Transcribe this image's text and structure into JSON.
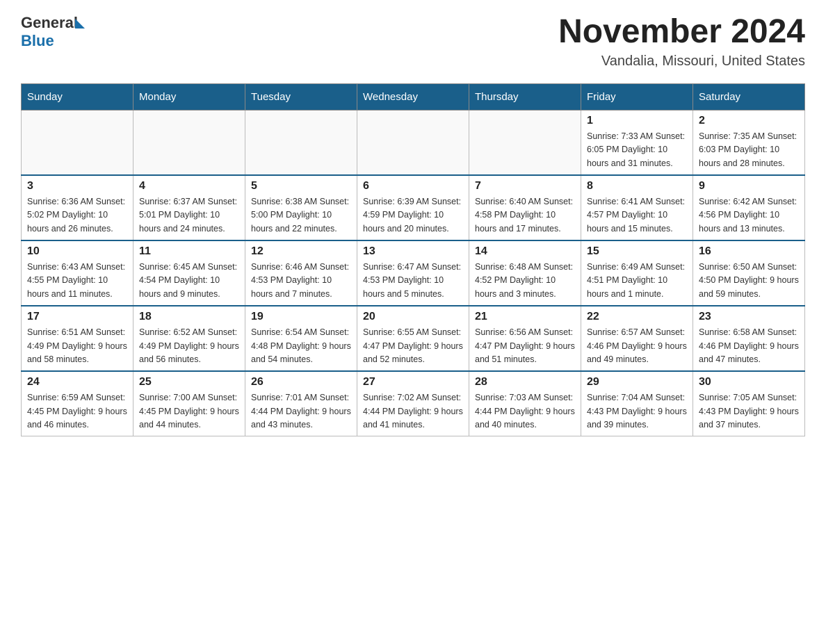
{
  "header": {
    "logo_general": "General",
    "logo_blue": "Blue",
    "month_year": "November 2024",
    "location": "Vandalia, Missouri, United States"
  },
  "days_of_week": [
    "Sunday",
    "Monday",
    "Tuesday",
    "Wednesday",
    "Thursday",
    "Friday",
    "Saturday"
  ],
  "weeks": [
    [
      {
        "day": "",
        "info": ""
      },
      {
        "day": "",
        "info": ""
      },
      {
        "day": "",
        "info": ""
      },
      {
        "day": "",
        "info": ""
      },
      {
        "day": "",
        "info": ""
      },
      {
        "day": "1",
        "info": "Sunrise: 7:33 AM\nSunset: 6:05 PM\nDaylight: 10 hours and 31 minutes."
      },
      {
        "day": "2",
        "info": "Sunrise: 7:35 AM\nSunset: 6:03 PM\nDaylight: 10 hours and 28 minutes."
      }
    ],
    [
      {
        "day": "3",
        "info": "Sunrise: 6:36 AM\nSunset: 5:02 PM\nDaylight: 10 hours and 26 minutes."
      },
      {
        "day": "4",
        "info": "Sunrise: 6:37 AM\nSunset: 5:01 PM\nDaylight: 10 hours and 24 minutes."
      },
      {
        "day": "5",
        "info": "Sunrise: 6:38 AM\nSunset: 5:00 PM\nDaylight: 10 hours and 22 minutes."
      },
      {
        "day": "6",
        "info": "Sunrise: 6:39 AM\nSunset: 4:59 PM\nDaylight: 10 hours and 20 minutes."
      },
      {
        "day": "7",
        "info": "Sunrise: 6:40 AM\nSunset: 4:58 PM\nDaylight: 10 hours and 17 minutes."
      },
      {
        "day": "8",
        "info": "Sunrise: 6:41 AM\nSunset: 4:57 PM\nDaylight: 10 hours and 15 minutes."
      },
      {
        "day": "9",
        "info": "Sunrise: 6:42 AM\nSunset: 4:56 PM\nDaylight: 10 hours and 13 minutes."
      }
    ],
    [
      {
        "day": "10",
        "info": "Sunrise: 6:43 AM\nSunset: 4:55 PM\nDaylight: 10 hours and 11 minutes."
      },
      {
        "day": "11",
        "info": "Sunrise: 6:45 AM\nSunset: 4:54 PM\nDaylight: 10 hours and 9 minutes."
      },
      {
        "day": "12",
        "info": "Sunrise: 6:46 AM\nSunset: 4:53 PM\nDaylight: 10 hours and 7 minutes."
      },
      {
        "day": "13",
        "info": "Sunrise: 6:47 AM\nSunset: 4:53 PM\nDaylight: 10 hours and 5 minutes."
      },
      {
        "day": "14",
        "info": "Sunrise: 6:48 AM\nSunset: 4:52 PM\nDaylight: 10 hours and 3 minutes."
      },
      {
        "day": "15",
        "info": "Sunrise: 6:49 AM\nSunset: 4:51 PM\nDaylight: 10 hours and 1 minute."
      },
      {
        "day": "16",
        "info": "Sunrise: 6:50 AM\nSunset: 4:50 PM\nDaylight: 9 hours and 59 minutes."
      }
    ],
    [
      {
        "day": "17",
        "info": "Sunrise: 6:51 AM\nSunset: 4:49 PM\nDaylight: 9 hours and 58 minutes."
      },
      {
        "day": "18",
        "info": "Sunrise: 6:52 AM\nSunset: 4:49 PM\nDaylight: 9 hours and 56 minutes."
      },
      {
        "day": "19",
        "info": "Sunrise: 6:54 AM\nSunset: 4:48 PM\nDaylight: 9 hours and 54 minutes."
      },
      {
        "day": "20",
        "info": "Sunrise: 6:55 AM\nSunset: 4:47 PM\nDaylight: 9 hours and 52 minutes."
      },
      {
        "day": "21",
        "info": "Sunrise: 6:56 AM\nSunset: 4:47 PM\nDaylight: 9 hours and 51 minutes."
      },
      {
        "day": "22",
        "info": "Sunrise: 6:57 AM\nSunset: 4:46 PM\nDaylight: 9 hours and 49 minutes."
      },
      {
        "day": "23",
        "info": "Sunrise: 6:58 AM\nSunset: 4:46 PM\nDaylight: 9 hours and 47 minutes."
      }
    ],
    [
      {
        "day": "24",
        "info": "Sunrise: 6:59 AM\nSunset: 4:45 PM\nDaylight: 9 hours and 46 minutes."
      },
      {
        "day": "25",
        "info": "Sunrise: 7:00 AM\nSunset: 4:45 PM\nDaylight: 9 hours and 44 minutes."
      },
      {
        "day": "26",
        "info": "Sunrise: 7:01 AM\nSunset: 4:44 PM\nDaylight: 9 hours and 43 minutes."
      },
      {
        "day": "27",
        "info": "Sunrise: 7:02 AM\nSunset: 4:44 PM\nDaylight: 9 hours and 41 minutes."
      },
      {
        "day": "28",
        "info": "Sunrise: 7:03 AM\nSunset: 4:44 PM\nDaylight: 9 hours and 40 minutes."
      },
      {
        "day": "29",
        "info": "Sunrise: 7:04 AM\nSunset: 4:43 PM\nDaylight: 9 hours and 39 minutes."
      },
      {
        "day": "30",
        "info": "Sunrise: 7:05 AM\nSunset: 4:43 PM\nDaylight: 9 hours and 37 minutes."
      }
    ]
  ]
}
